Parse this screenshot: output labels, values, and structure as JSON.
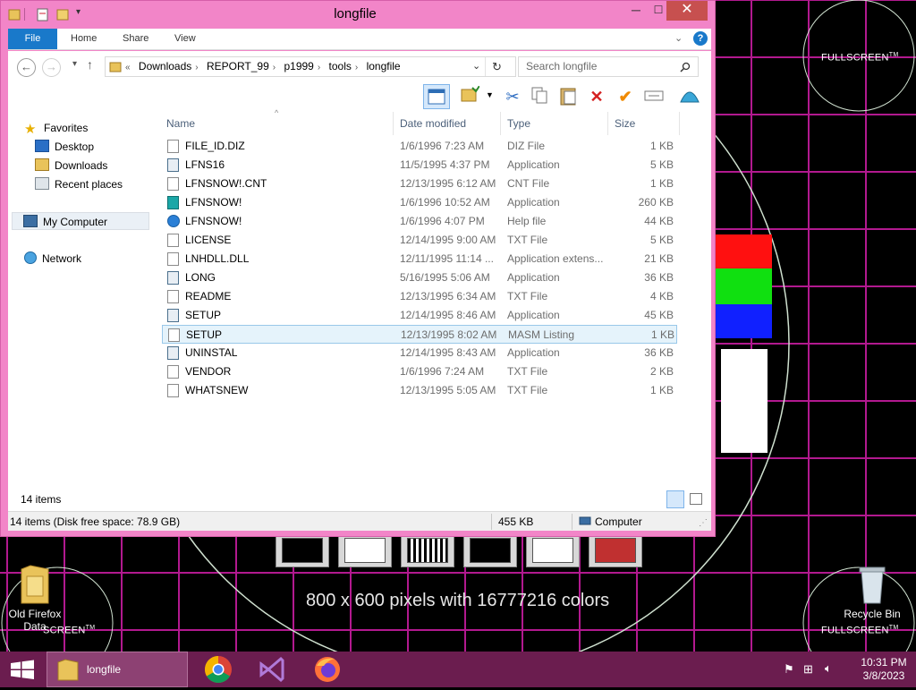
{
  "window": {
    "title": "longfile",
    "minimize": "─",
    "maximize": "☐",
    "close": "✕"
  },
  "ribbon": {
    "tabs": [
      "File",
      "Home",
      "Share",
      "View"
    ]
  },
  "address": {
    "prefix": "«",
    "crumbs": [
      "Downloads",
      "REPORT_99",
      "p1999",
      "tools",
      "longfile"
    ],
    "search_placeholder": "Search longfile"
  },
  "nav": {
    "favorites": "Favorites",
    "desktop": "Desktop",
    "downloads": "Downloads",
    "recent": "Recent places",
    "computer": "My Computer",
    "network": "Network"
  },
  "columns": {
    "name": "Name",
    "date": "Date modified",
    "type": "Type",
    "size": "Size"
  },
  "files": [
    {
      "name": "FILE_ID.DIZ",
      "date": "1/6/1996 7:23 AM",
      "type": "DIZ File",
      "size": "1 KB",
      "icon": "document-icon"
    },
    {
      "name": "LFNS16",
      "date": "11/5/1995 4:37 PM",
      "type": "Application",
      "size": "5 KB",
      "icon": "app-icon"
    },
    {
      "name": "LFNSNOW!.CNT",
      "date": "12/13/1995 6:12 AM",
      "type": "CNT File",
      "size": "1 KB",
      "icon": "document-icon"
    },
    {
      "name": "LFNSNOW!",
      "date": "1/6/1996 10:52 AM",
      "type": "Application",
      "size": "260 KB",
      "icon": "lfn-app-icon"
    },
    {
      "name": "LFNSNOW!",
      "date": "1/6/1996 4:07 PM",
      "type": "Help file",
      "size": "44 KB",
      "icon": "help-icon"
    },
    {
      "name": "LICENSE",
      "date": "12/14/1995 9:00 AM",
      "type": "TXT File",
      "size": "5 KB",
      "icon": "text-icon"
    },
    {
      "name": "LNHDLL.DLL",
      "date": "12/11/1995 11:14 ...",
      "type": "Application extens...",
      "size": "21 KB",
      "icon": "dll-icon"
    },
    {
      "name": "LONG",
      "date": "5/16/1995 5:06 AM",
      "type": "Application",
      "size": "36 KB",
      "icon": "app-icon"
    },
    {
      "name": "README",
      "date": "12/13/1995 6:34 AM",
      "type": "TXT File",
      "size": "4 KB",
      "icon": "text-icon"
    },
    {
      "name": "SETUP",
      "date": "12/14/1995 8:46 AM",
      "type": "Application",
      "size": "45 KB",
      "icon": "setup-icon"
    },
    {
      "name": "SETUP",
      "date": "12/13/1995 8:02 AM",
      "type": "MASM Listing",
      "size": "1 KB",
      "icon": "listing-icon",
      "selected": true
    },
    {
      "name": "UNINSTAL",
      "date": "12/14/1995 8:43 AM",
      "type": "Application",
      "size": "36 KB",
      "icon": "setup-icon"
    },
    {
      "name": "VENDOR",
      "date": "1/6/1996 7:24 AM",
      "type": "TXT File",
      "size": "2 KB",
      "icon": "text-icon"
    },
    {
      "name": "WHATSNEW",
      "date": "12/13/1995 5:05 AM",
      "type": "TXT File",
      "size": "1 KB",
      "icon": "text-icon"
    }
  ],
  "status": {
    "items_count": "14 items",
    "disk_info": "14 items (Disk free space: 78.9 GB)",
    "selected_size": "455 KB",
    "location": "Computer"
  },
  "desktop": {
    "corner_label": "FULLSCREEN",
    "tm": "TM",
    "resolution_text": "800 x 600 pixels with 16777216 colors",
    "icon_old_firefox": "Old Firefox",
    "icon_old_firefox_sub": "Data",
    "icon_recycle_bin": "Recycle Bin",
    "bottom_left_label": "SCREEN",
    "bottom_right_label": "FULLSCREEN"
  },
  "taskbar": {
    "explorer_label": "longfile",
    "time": "10:31 PM",
    "date": "3/8/2023"
  },
  "colors": {
    "window_frame": "#f285c8",
    "file_tab": "#1979ca",
    "taskbar": "#6b1d4f",
    "grid_lines": "#b2198f",
    "close_button": "#c7504f"
  }
}
